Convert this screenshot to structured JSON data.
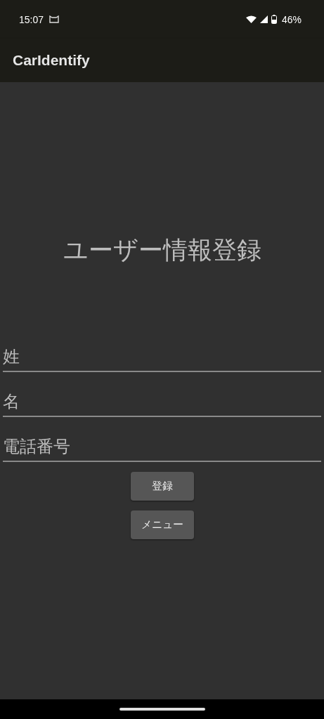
{
  "status_bar": {
    "time": "15:07",
    "battery": "46%"
  },
  "app_bar": {
    "title": "CarIdentify"
  },
  "heading": "ユーザー情報登録",
  "fields": [
    {
      "placeholder": "姓"
    },
    {
      "placeholder": "名"
    },
    {
      "placeholder": "電話番号"
    }
  ],
  "buttons": [
    "登録",
    "メニュー"
  ]
}
